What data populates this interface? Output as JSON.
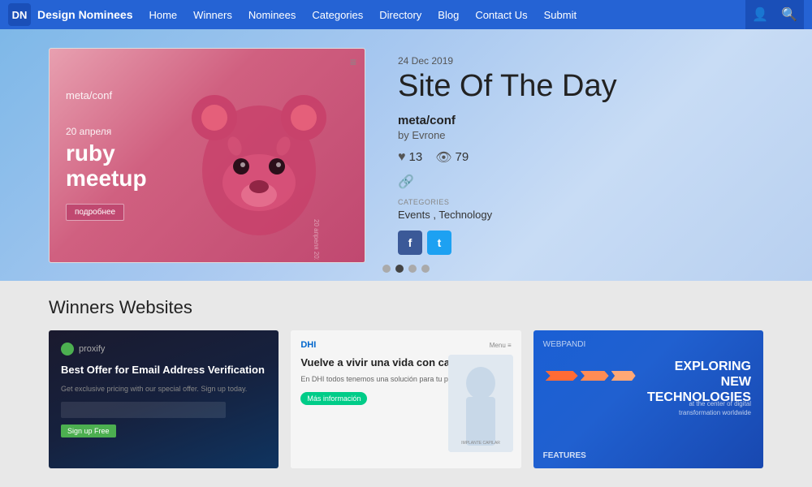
{
  "header": {
    "logo_letters": "DN",
    "brand_name": "Design Nominees",
    "nav_items": [
      {
        "label": "Home",
        "id": "home"
      },
      {
        "label": "Winners",
        "id": "winners"
      },
      {
        "label": "Nominees",
        "id": "nominees"
      },
      {
        "label": "Categories",
        "id": "categories"
      },
      {
        "label": "Directory",
        "id": "directory"
      },
      {
        "label": "Blog",
        "id": "blog"
      },
      {
        "label": "Contact Us",
        "id": "contact"
      },
      {
        "label": "Submit",
        "id": "submit"
      }
    ]
  },
  "hero": {
    "date": "24 Dec 2019",
    "title": "Site Of The Day",
    "site_name": "meta/conf",
    "author": "by Evrone",
    "likes": "13",
    "views": "79",
    "categories_label": "CATEGORIES",
    "categories": "Events , Technology",
    "image": {
      "site_label": "meta/conf",
      "date_line": "20 апреля",
      "main_line1": "ruby",
      "main_line2": "meetup",
      "btn_label": "подробнее"
    }
  },
  "dots": [
    {
      "active": false,
      "id": 1
    },
    {
      "active": true,
      "id": 2
    },
    {
      "active": false,
      "id": 3
    },
    {
      "active": false,
      "id": 4
    }
  ],
  "winners_section": {
    "title": "Winners Websites",
    "cards": [
      {
        "id": "card1",
        "logo": "proxify",
        "headline": "Best Offer for Email Address Verification",
        "sub": "Get exclusive pricing with our special offer. Sign up today.",
        "btn": "Sign up Free"
      },
      {
        "id": "card2",
        "logo": "DHI",
        "headline": "Vuelve a vivir una vida con cabello.",
        "sub": "En DHI todos tenemos una solución para tu problema capilar.",
        "btn": "Más información",
        "image_label": "IMPLANTE CAPILAR"
      },
      {
        "id": "card3",
        "logo_nav": "WEBPANDI",
        "headline": "EXPLORING\nNEW\nTECHNOLOGIES",
        "sub": "at the center of digital transformation worldwide",
        "bottom_label": "FEATURES"
      }
    ]
  },
  "icons": {
    "heart": "♥",
    "eye": "👁",
    "link": "🔗",
    "user": "👤",
    "search": "🔍",
    "fb": "f",
    "tw": "t",
    "menu": "≡"
  }
}
